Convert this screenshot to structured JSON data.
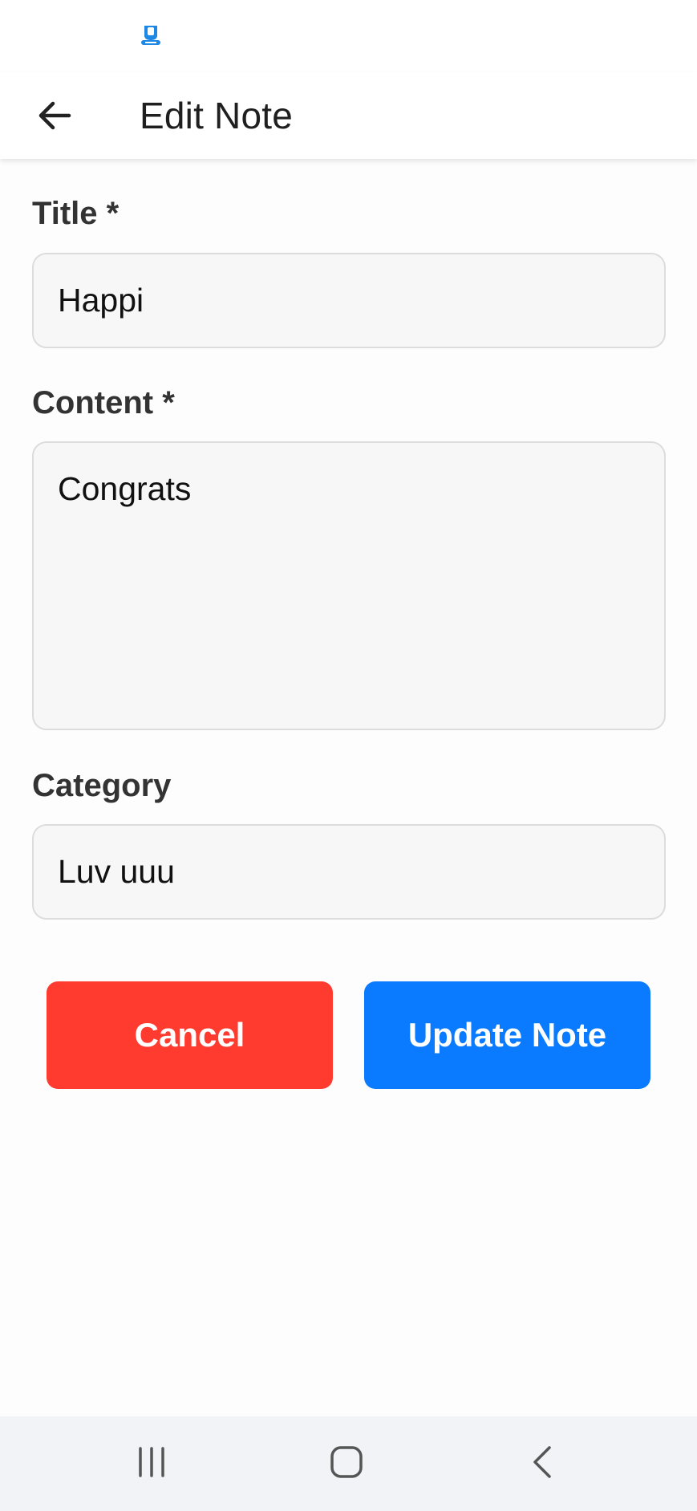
{
  "status_bar": {
    "app_icon": "app-notification-icon"
  },
  "header": {
    "back_icon": "arrow-left-icon",
    "title": "Edit Note"
  },
  "form": {
    "title_label": "Title *",
    "title_value": "Happi",
    "content_label": "Content *",
    "content_value": "Congrats",
    "category_label": "Category",
    "category_value": "Luv uuu"
  },
  "actions": {
    "cancel_label": "Cancel",
    "update_label": "Update Note"
  },
  "colors": {
    "cancel": "#ff3b30",
    "primary": "#0a7bff",
    "field_background": "#f7f7f7",
    "nav_background": "#f2f3f7"
  },
  "system_nav": {
    "recents_icon": "recents-icon",
    "home_icon": "home-icon",
    "back_icon": "system-back-icon"
  }
}
